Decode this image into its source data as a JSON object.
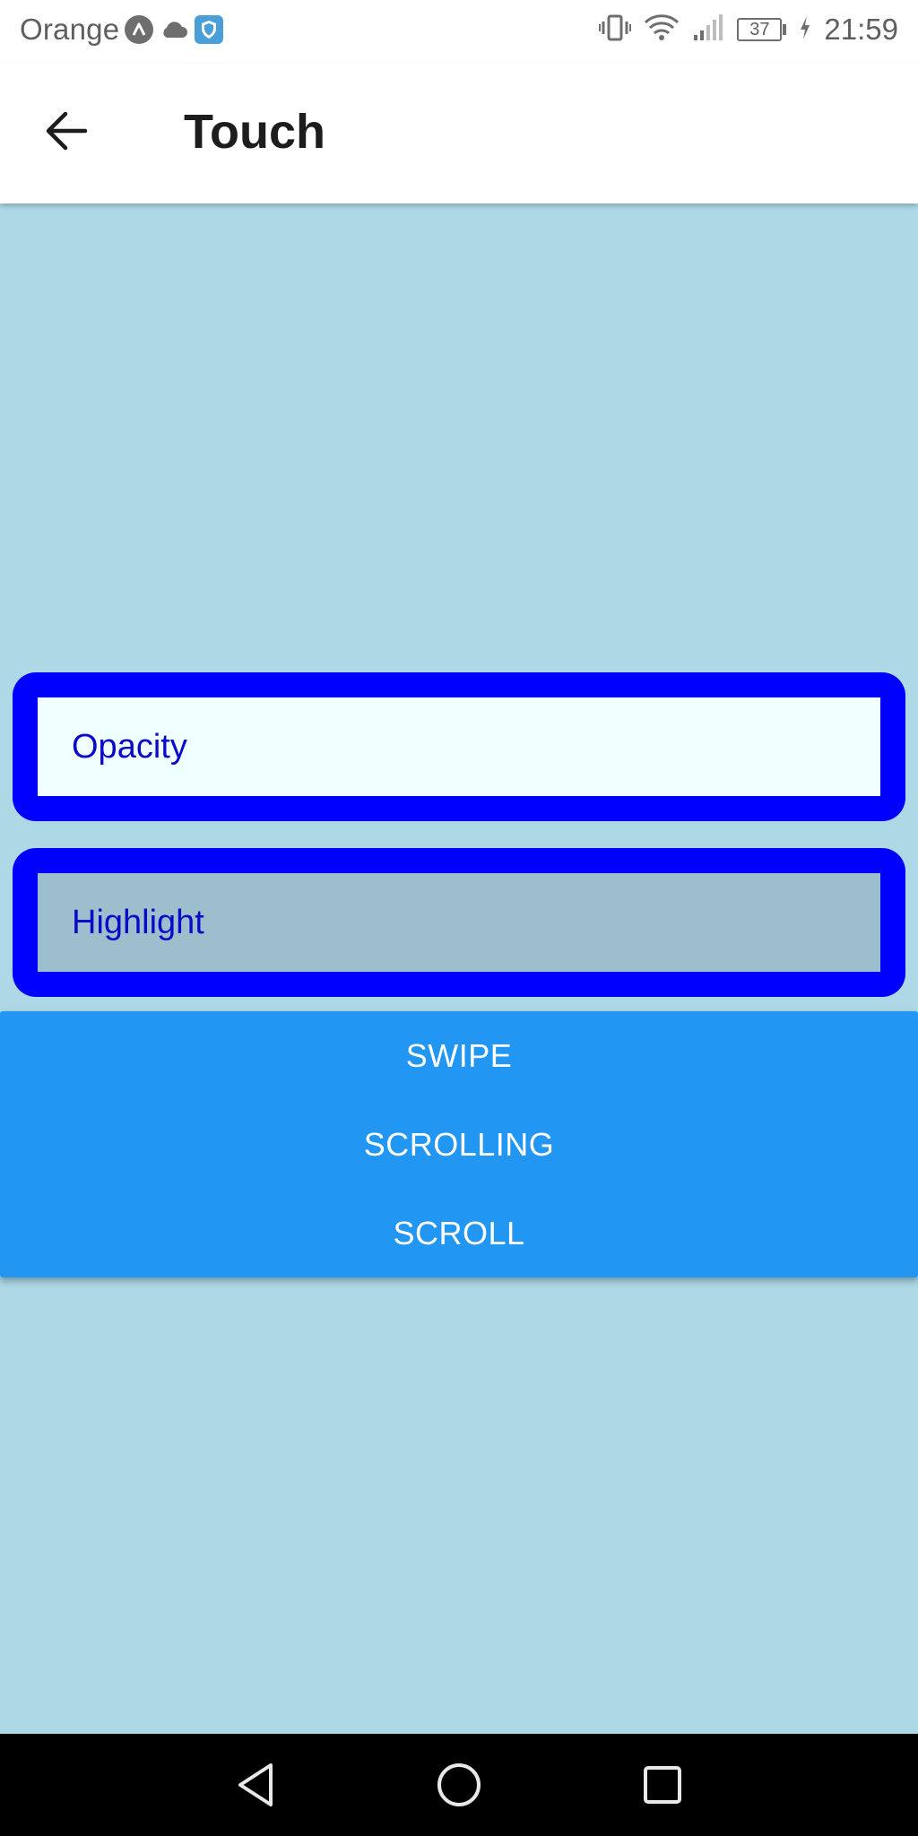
{
  "status_bar": {
    "carrier": "Orange",
    "battery_level": "37",
    "time": "21:59",
    "icons": [
      "app-a-icon",
      "cloud-icon",
      "shield-icon",
      "vibrate-icon",
      "wifi-icon",
      "signal-icon",
      "battery-icon",
      "charging-icon"
    ]
  },
  "app_bar": {
    "title": "Touch",
    "back_icon": "arrow-left-icon"
  },
  "touch_boxes": {
    "opacity_label": "Opacity",
    "highlight_label": "Highlight"
  },
  "buttons": {
    "swipe": "SWIPE",
    "scrolling": "SCROLLING",
    "scroll": "SCROLL"
  },
  "nav_bar": {
    "icons": [
      "back-triangle-icon",
      "home-circle-icon",
      "recents-square-icon"
    ]
  },
  "colors": {
    "background": "#add8e6",
    "box_border": "#0000ff",
    "box_text": "#0a0ac8",
    "opacity_fill": "#f0ffff",
    "highlight_fill": "#9dbecc",
    "button_blue": "#2196f3"
  }
}
